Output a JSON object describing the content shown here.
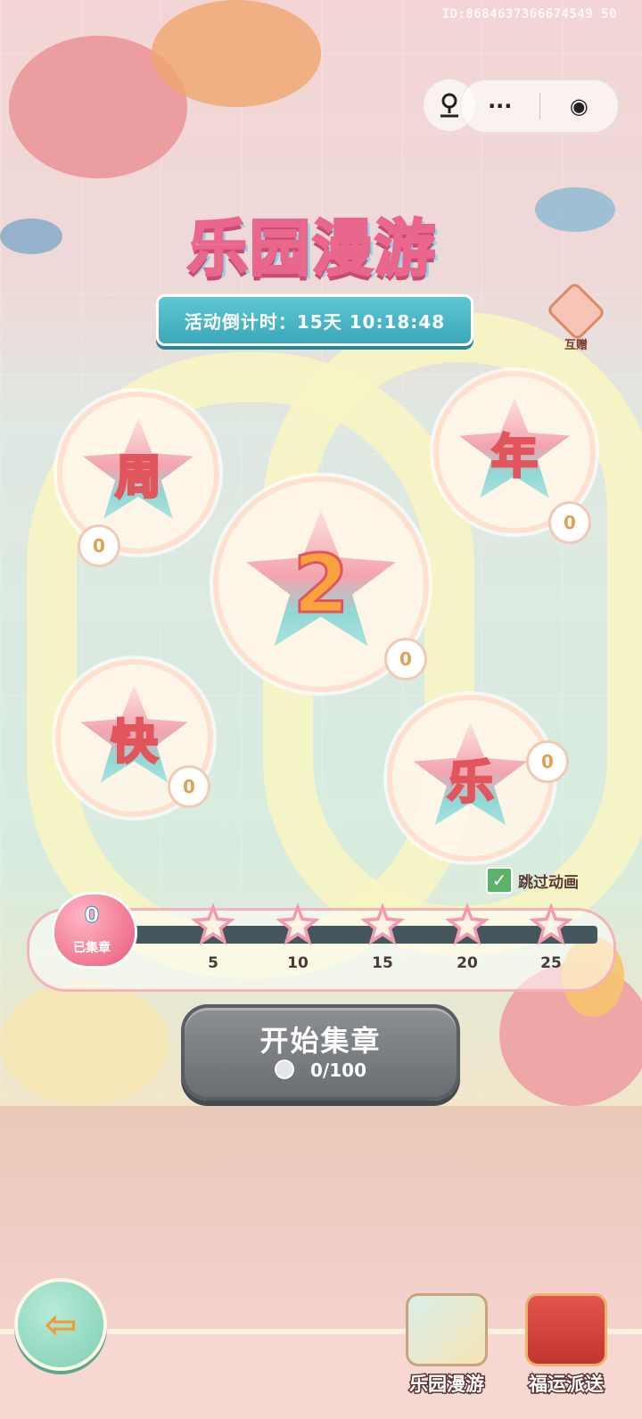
{
  "top": {
    "id_text": "ID:8684637366674549 50"
  },
  "capsule": {
    "more": "···",
    "close": "◉"
  },
  "header": {
    "title": "乐园漫游",
    "countdown": "活动倒计时：15天 10:18:48"
  },
  "gift": {
    "label": "互赠"
  },
  "stamps": [
    {
      "char": "周",
      "count": "0"
    },
    {
      "char": "年",
      "count": "0"
    },
    {
      "char": "2",
      "count": "0"
    },
    {
      "char": "快",
      "count": "0"
    },
    {
      "char": "乐",
      "count": "0"
    }
  ],
  "skip": {
    "label": "跳过动画",
    "checked": true
  },
  "progress": {
    "collected_value": "0",
    "collected_label": "已集章",
    "milestones": [
      "5",
      "10",
      "15",
      "20",
      "25"
    ]
  },
  "start_button": {
    "label": "开始集章",
    "counter": "0/100"
  },
  "bottom": {
    "back_icon": "back-arrow-icon",
    "tabs": [
      {
        "label": "乐园漫游"
      },
      {
        "label": "福运派送"
      }
    ]
  }
}
